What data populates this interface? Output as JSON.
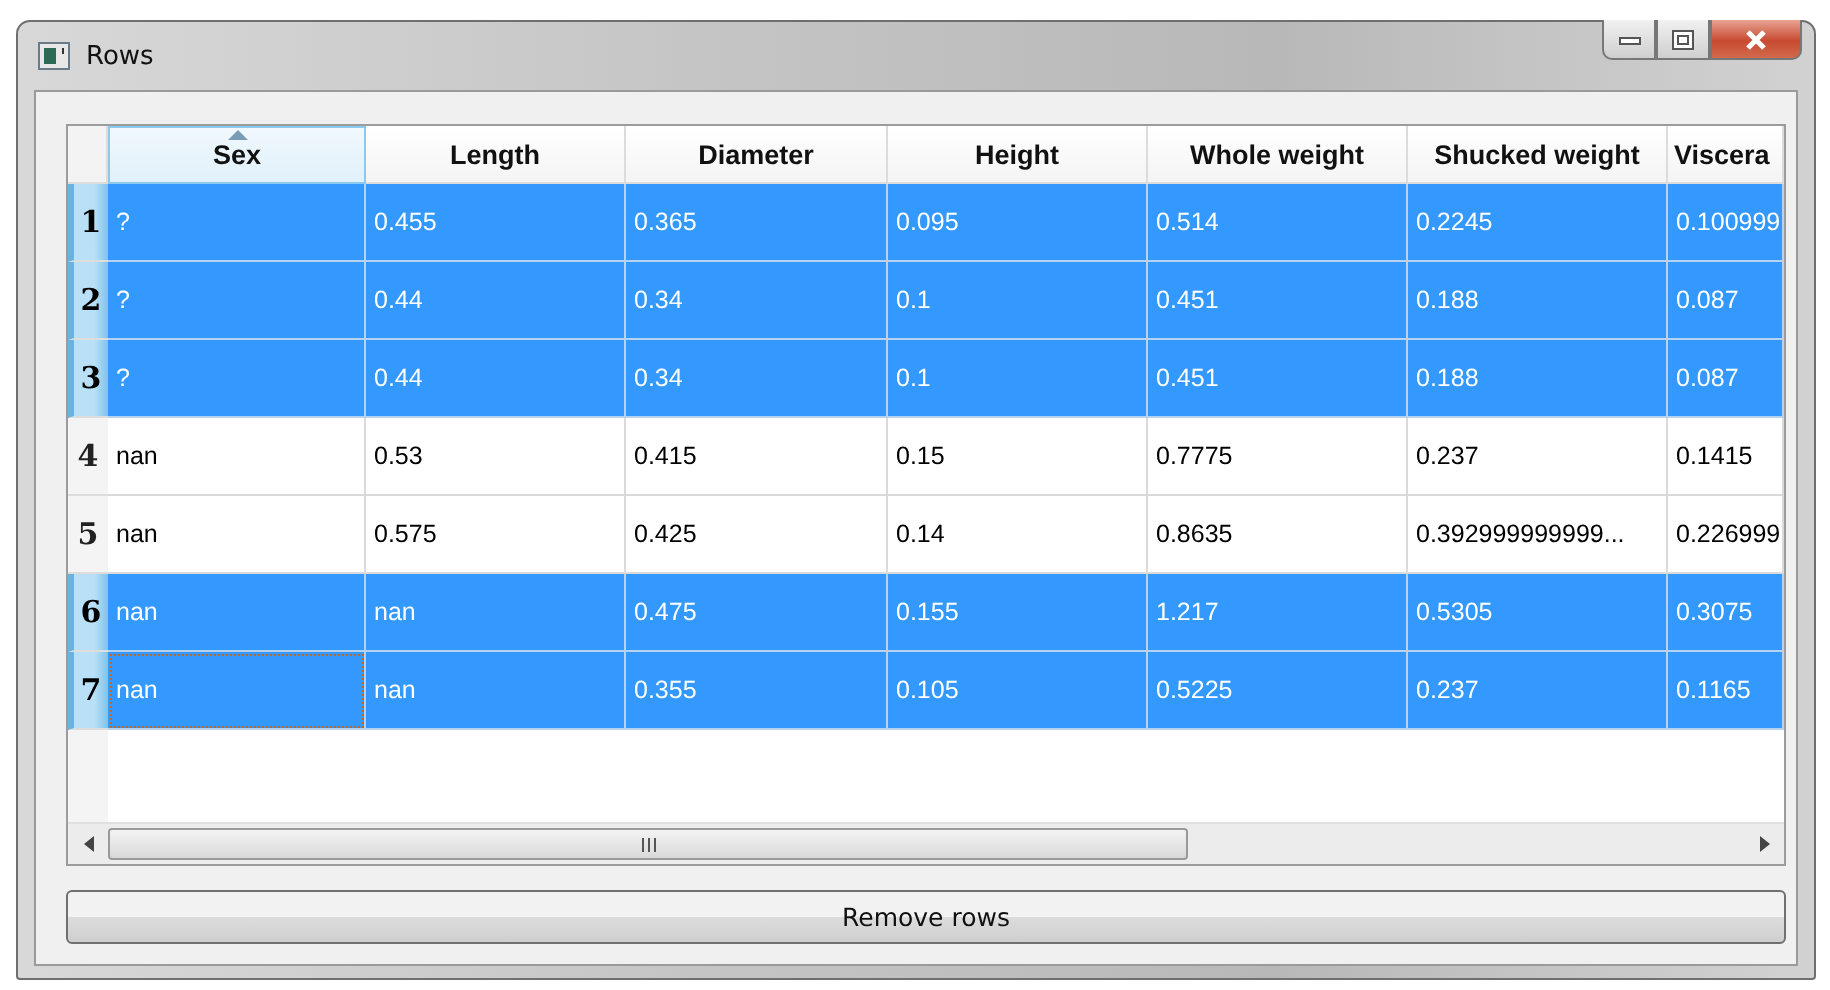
{
  "window": {
    "title": "Rows"
  },
  "table": {
    "columns": [
      {
        "label": "Sex",
        "sorted": true
      },
      {
        "label": "Length",
        "sorted": false
      },
      {
        "label": "Diameter",
        "sorted": false
      },
      {
        "label": "Height",
        "sorted": false
      },
      {
        "label": "Whole weight",
        "sorted": false
      },
      {
        "label": "Shucked weight",
        "sorted": false
      },
      {
        "label": "Viscera",
        "sorted": false
      }
    ],
    "rows": [
      {
        "label": "1",
        "selected": true,
        "focused": false,
        "cells": [
          "?",
          "0.455",
          "0.365",
          "0.095",
          "0.514",
          "0.2245",
          "0.100999"
        ]
      },
      {
        "label": "2",
        "selected": true,
        "focused": false,
        "cells": [
          "?",
          "0.44",
          "0.34",
          "0.1",
          "0.451",
          "0.188",
          "0.087"
        ]
      },
      {
        "label": "3",
        "selected": true,
        "focused": false,
        "cells": [
          "?",
          "0.44",
          "0.34",
          "0.1",
          "0.451",
          "0.188",
          "0.087"
        ]
      },
      {
        "label": "4",
        "selected": false,
        "focused": false,
        "cells": [
          "nan",
          "0.53",
          "0.415",
          "0.15",
          "0.7775",
          "0.237",
          "0.1415"
        ]
      },
      {
        "label": "5",
        "selected": false,
        "focused": false,
        "cells": [
          "nan",
          "0.575",
          "0.425",
          "0.14",
          "0.8635",
          "0.392999999999...",
          "0.226999"
        ]
      },
      {
        "label": "6",
        "selected": true,
        "focused": false,
        "cells": [
          "nan",
          "nan",
          "0.475",
          "0.155",
          "1.217",
          "0.5305",
          "0.3075"
        ]
      },
      {
        "label": "7",
        "selected": true,
        "focused": true,
        "cells": [
          "nan",
          "nan",
          "0.355",
          "0.105",
          "0.5225",
          "0.237",
          "0.1165"
        ]
      }
    ]
  },
  "buttons": [
    {
      "label": "Remove rows"
    }
  ]
}
